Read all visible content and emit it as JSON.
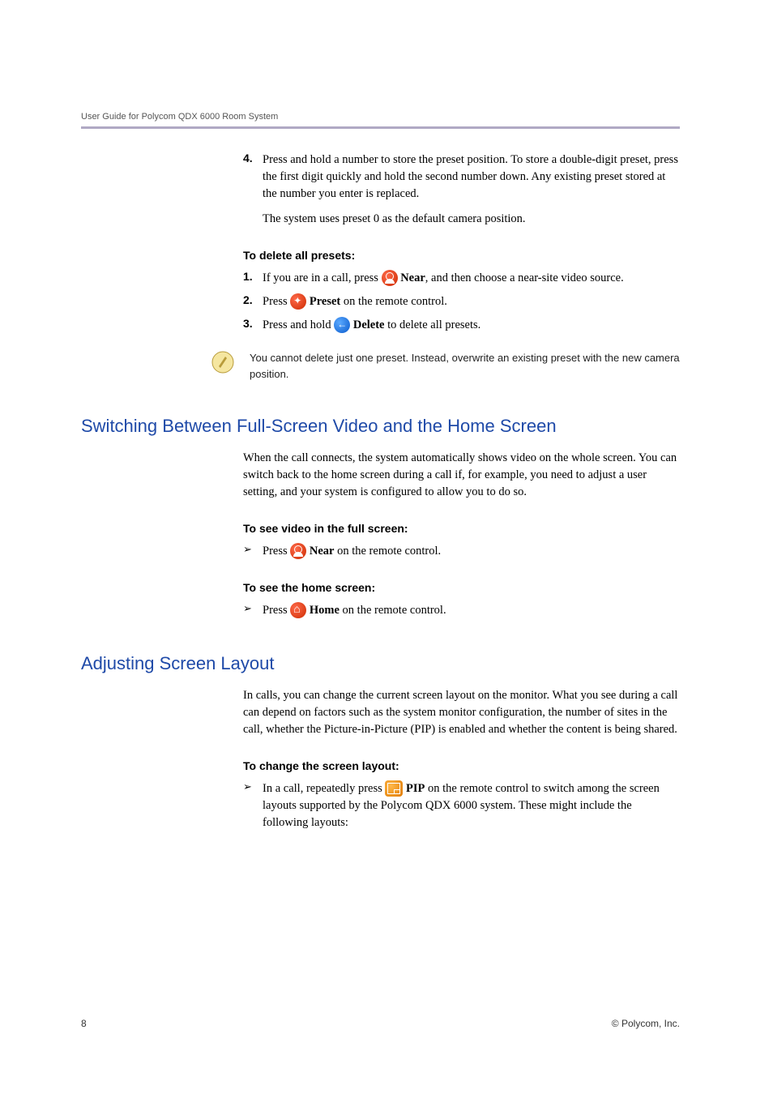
{
  "header": {
    "running_head": "User Guide for Polycom QDX 6000 Room System"
  },
  "step4": {
    "num": "4.",
    "text": "Press and hold a number to store the preset position. To store a double-digit preset, press the first digit quickly and hold the second number down. Any existing preset stored at the number you enter is replaced.",
    "sub": "The system uses preset 0 as the default camera position."
  },
  "delete_presets": {
    "heading": "To delete all presets:",
    "s1": {
      "num": "1.",
      "pre": "If you are in a call, press ",
      "btn": "Near",
      "post": ", and then choose a near-site video source."
    },
    "s2": {
      "num": "2.",
      "pre": "Press ",
      "btn": "Preset",
      "post": " on the remote control."
    },
    "s3": {
      "num": "3.",
      "pre": "Press and hold ",
      "btn": "Delete",
      "post": " to delete all presets."
    }
  },
  "note": {
    "text": "You cannot delete just one preset. Instead, overwrite an existing preset with the new camera position."
  },
  "switching": {
    "heading": "Switching Between Full-Screen Video and the Home Screen",
    "para": "When the call connects, the system automatically shows video on the whole screen. You can switch back to the home screen during a call if, for example, you need to adjust a user setting, and your system is configured to allow you to do so.",
    "full": {
      "heading": "To see video in the full screen:",
      "pre": "Press ",
      "btn": "Near",
      "post": " on the remote control."
    },
    "home": {
      "heading": "To see the home screen:",
      "pre": "Press ",
      "btn": "Home",
      "post": " on the remote control."
    }
  },
  "layout": {
    "heading": "Adjusting Screen Layout",
    "para": "In calls, you can change the current screen layout on the monitor. What you see during a call can depend on factors such as the system monitor configuration, the number of sites in the call, whether the Picture-in-Picture (PIP) is enabled and whether the content is being shared.",
    "change": {
      "heading": "To change the screen layout:",
      "pre": "In a call, repeatedly press ",
      "btn": "PIP",
      "post": " on the remote control to switch among the screen layouts supported by the Polycom QDX 6000 system. These might include the following layouts:"
    }
  },
  "footer": {
    "page": "8",
    "copyright": "© Polycom, Inc."
  },
  "bullets": {
    "tri": "➢"
  }
}
